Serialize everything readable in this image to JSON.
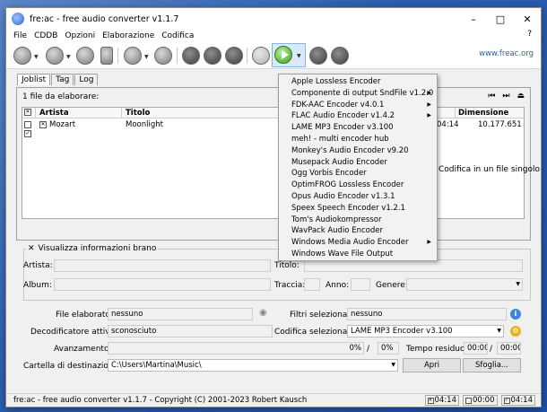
{
  "window": {
    "title": "fre:ac - free audio converter v1.1.7"
  },
  "menu": [
    "File",
    "CDDB",
    "Opzioni",
    "Elaborazione",
    "Codifica"
  ],
  "help_label": "?",
  "toolbar": {
    "link": "www.freac.org"
  },
  "tabs": [
    "Joblist",
    "Tag",
    "Log"
  ],
  "joblist": {
    "count": "1 file da elaborare:",
    "columns": {
      "artist": "Artista",
      "title": "Titolo",
      "size": "Dimensione"
    },
    "row": {
      "artist": "Mozart",
      "title": "Moonlight",
      "time": "04:14",
      "size": "10.177.651"
    }
  },
  "single_file_label": "Codifica in un file singolo",
  "info": {
    "toggle_label": "Visualizza informazioni brano",
    "artist_label": "Artista:",
    "title_label": "Titolo:",
    "album_label": "Album:",
    "track_label": "Traccia:",
    "year_label": "Anno:",
    "genre_label": "Genere:"
  },
  "status": {
    "processed_label": "File elaborato:",
    "processed_value": "nessuno",
    "filters_label": "Filtri selezionati:",
    "filters_value": "nessuno",
    "decoder_label": "Decodificatore attivo:",
    "decoder_value": "sconosciuto",
    "encoder_label": "Codifica selezionata:",
    "encoder_value": "LAME MP3 Encoder v3.100",
    "progress_label": "Avanzamento:",
    "progress_pct1": "0%",
    "progress_pct2": "0%",
    "remaining_label": "Tempo residuo:",
    "remaining_1": "00:00",
    "remaining_2": "00:00",
    "dest_label": "Cartella di destinazione:",
    "dest_value": "C:\\Users\\Martina\\Music\\",
    "open_button": "Apri",
    "browse_button": "Sfoglia...",
    "slash": "/"
  },
  "statusbar": {
    "text": "fre:ac - free audio converter v1.1.7 - Copyright (C) 2001-2023 Robert Kausch",
    "t1": "04:14",
    "t2": "00:00",
    "t3": "04:14"
  },
  "encoders": [
    {
      "label": "Apple Lossless Encoder",
      "submenu": false
    },
    {
      "label": "Componente di output SndFile v1.2.0",
      "submenu": true
    },
    {
      "label": "FDK-AAC Encoder v4.0.1",
      "submenu": true
    },
    {
      "label": "FLAC Audio Encoder v1.4.2",
      "submenu": true
    },
    {
      "label": "LAME MP3 Encoder v3.100",
      "submenu": false
    },
    {
      "label": "meh! - multi encoder hub",
      "submenu": false
    },
    {
      "label": "Monkey's Audio Encoder v9.20",
      "submenu": false
    },
    {
      "label": "Musepack Audio Encoder",
      "submenu": false
    },
    {
      "label": "Ogg Vorbis Encoder",
      "submenu": false
    },
    {
      "label": "OptimFROG Lossless Encoder",
      "submenu": false
    },
    {
      "label": "Opus Audio Encoder v1.3.1",
      "submenu": false
    },
    {
      "label": "Speex Speech Encoder v1.2.1",
      "submenu": false
    },
    {
      "label": "Tom's Audiokompressor",
      "submenu": false
    },
    {
      "label": "WavPack Audio Encoder",
      "submenu": false
    },
    {
      "label": "Windows Media Audio Encoder",
      "submenu": true
    },
    {
      "label": "Windows Wave File Output",
      "submenu": false
    }
  ]
}
